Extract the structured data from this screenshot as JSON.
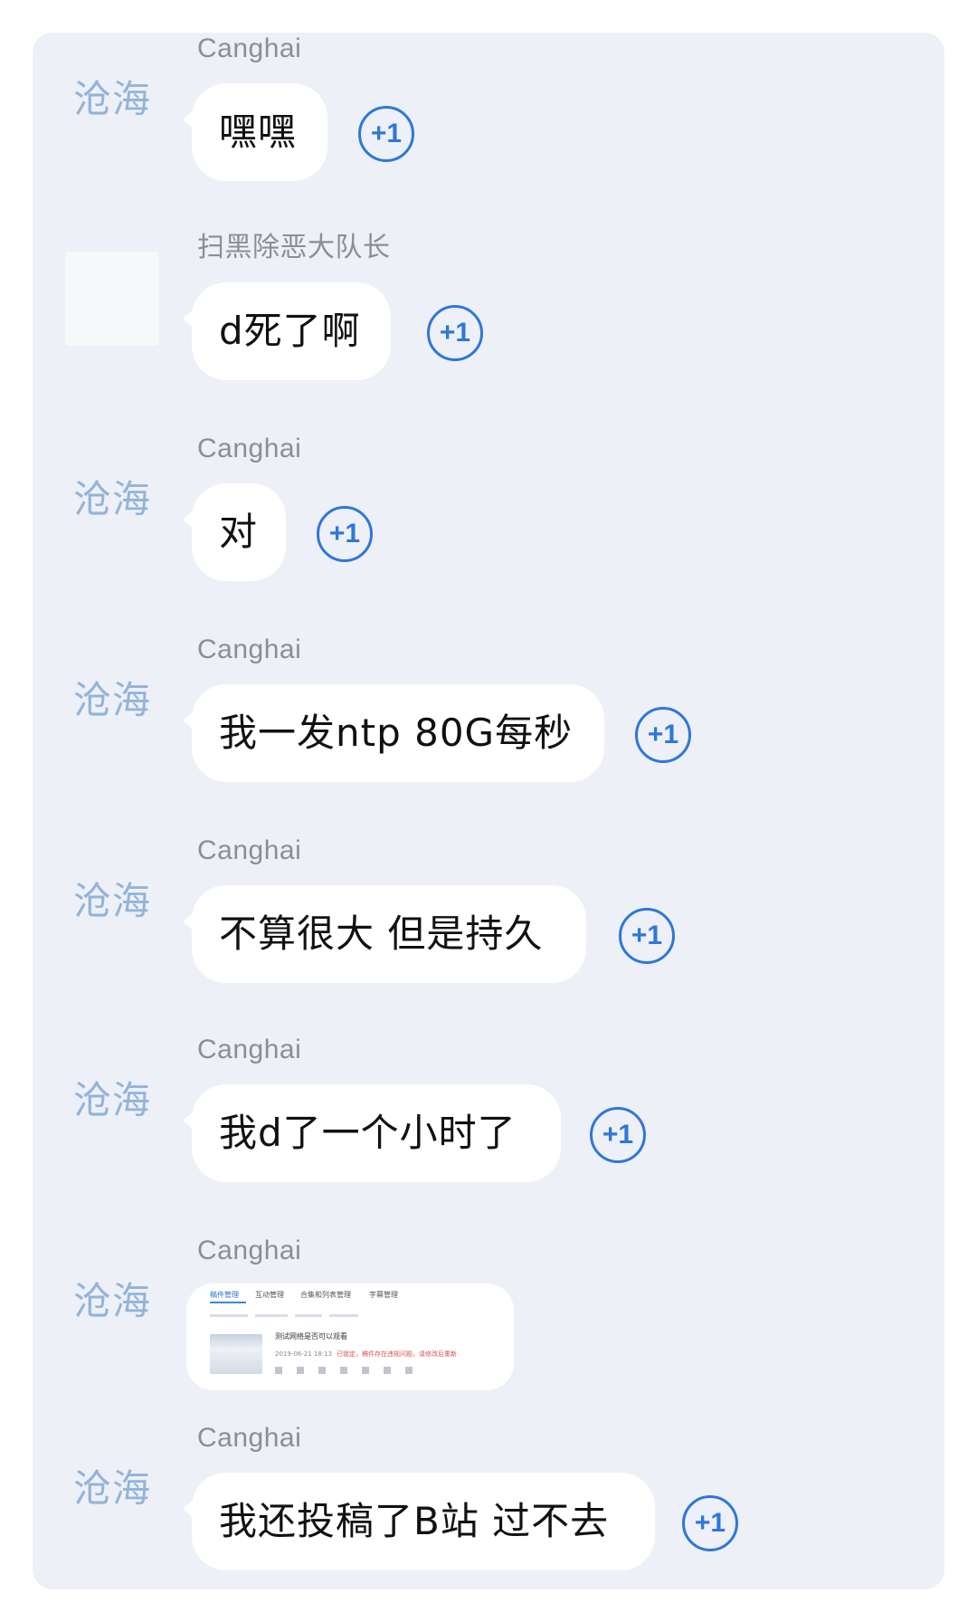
{
  "chat": {
    "plus_label": "+1",
    "messages": [
      {
        "avatar": "沧海",
        "sender": "Canghai",
        "text": "嘿嘿"
      },
      {
        "avatar": "",
        "sender": "扫黑除恶大队长",
        "text": "d死了啊"
      },
      {
        "avatar": "沧海",
        "sender": "Canghai",
        "text": "对"
      },
      {
        "avatar": "沧海",
        "sender": "Canghai",
        "text": "我一发ntp 80G每秒"
      },
      {
        "avatar": "沧海",
        "sender": "Canghai",
        "text": "不算很大 但是持久"
      },
      {
        "avatar": "沧海",
        "sender": "Canghai",
        "text": "我d了一个小时了"
      },
      {
        "avatar": "沧海",
        "sender": "Canghai",
        "image": {
          "tabs": [
            "稿件管理",
            "互动管理",
            "合集和列表管理",
            "字幕管理"
          ],
          "title": "测试网络是否可以观看",
          "date": "2019-06-21 18:13",
          "warning": "已锁定，稿件存在违规问题，请修改后重新"
        }
      },
      {
        "avatar": "沧海",
        "sender": "Canghai",
        "text": "我还投稿了B站 过不去"
      }
    ]
  }
}
